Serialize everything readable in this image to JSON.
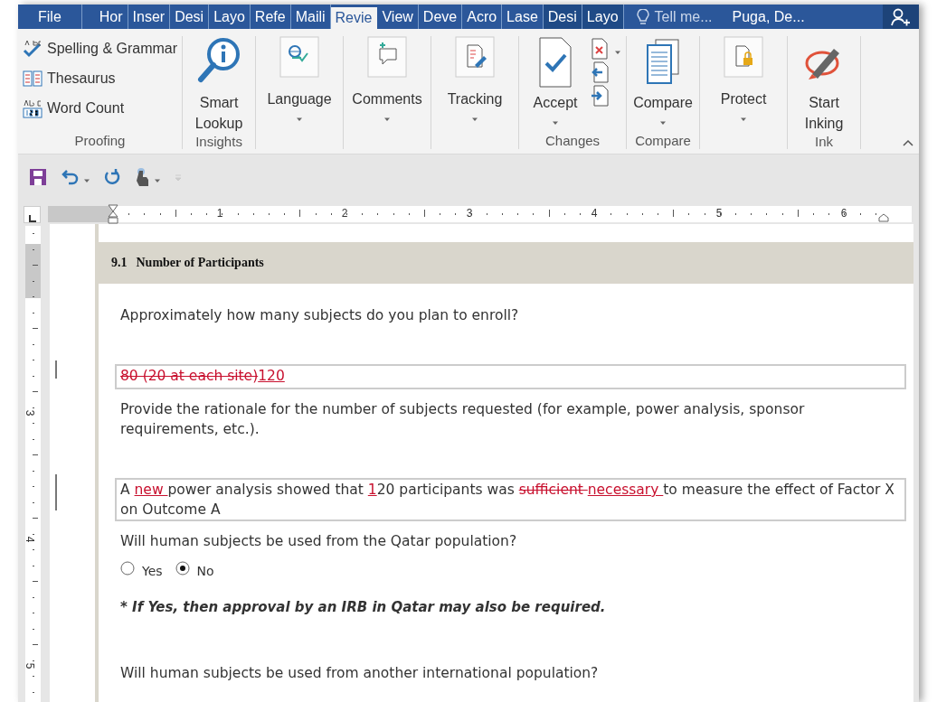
{
  "ribbon_tabs": [
    {
      "label": "File",
      "selected": false,
      "kind": "file"
    },
    {
      "label": "Hor",
      "selected": false,
      "kind": "tab"
    },
    {
      "label": "Inser",
      "selected": false,
      "kind": "tab"
    },
    {
      "label": "Desi",
      "selected": false,
      "kind": "tab"
    },
    {
      "label": "Layo",
      "selected": false,
      "kind": "tab"
    },
    {
      "label": "Refe",
      "selected": false,
      "kind": "tab"
    },
    {
      "label": "Maili",
      "selected": false,
      "kind": "tab"
    },
    {
      "label": "Revie",
      "selected": true,
      "kind": "tab"
    },
    {
      "label": "View",
      "selected": false,
      "kind": "tab"
    },
    {
      "label": "Deve",
      "selected": false,
      "kind": "tab"
    },
    {
      "label": "Acro",
      "selected": false,
      "kind": "tab"
    },
    {
      "label": "Lase",
      "selected": false,
      "kind": "tab"
    },
    {
      "label": "Desi",
      "selected": false,
      "kind": "contextual"
    },
    {
      "label": "Layo",
      "selected": false,
      "kind": "contextual"
    }
  ],
  "tell_me": {
    "placeholder": "Tell me..."
  },
  "user": "Puga, De...",
  "ribbon_groups": [
    {
      "label": "Proofing",
      "buttons": [
        {
          "kind": "small",
          "lines": [
            "Spelling & Grammar"
          ],
          "dropdown": false
        },
        {
          "kind": "small",
          "lines": [
            "Thesaurus"
          ],
          "dropdown": false
        },
        {
          "kind": "small",
          "lines": [
            "Word Count"
          ],
          "dropdown": false
        }
      ]
    },
    {
      "label": "Insights",
      "buttons": [
        {
          "kind": "large",
          "lines": [
            "Smart",
            "Lookup"
          ],
          "dropdown": false
        }
      ]
    },
    {
      "buttons": [
        {
          "kind": "boxed",
          "lines": [
            "Language"
          ],
          "dropdown": true
        }
      ]
    },
    {
      "buttons": [
        {
          "kind": "boxed",
          "lines": [
            "Comments"
          ],
          "dropdown": true
        }
      ]
    },
    {
      "buttons": [
        {
          "kind": "boxed",
          "lines": [
            "Tracking"
          ],
          "dropdown": true
        }
      ]
    },
    {
      "label": "Changes",
      "buttons": [
        {
          "kind": "large",
          "lines": [
            "Accept"
          ],
          "dropdown": true
        },
        {
          "kind": "icons"
        }
      ]
    },
    {
      "label": "Compare",
      "buttons": [
        {
          "kind": "large",
          "lines": [
            "Compare"
          ],
          "dropdown": true
        }
      ]
    },
    {
      "buttons": [
        {
          "kind": "boxed",
          "lines": [
            "Protect"
          ],
          "dropdown": true
        }
      ]
    },
    {
      "label": "Ink",
      "buttons": [
        {
          "kind": "large",
          "lines": [
            "Start",
            "Inking"
          ],
          "dropdown": false
        }
      ]
    }
  ],
  "ruler": {
    "marks": [
      "1",
      "2",
      "3",
      "4",
      "5",
      "6"
    ]
  },
  "vertical_ruler": {
    "marks": [
      "3",
      "4",
      "5"
    ]
  },
  "document": {
    "section_number": "9.1",
    "section_title": "Number of Participants",
    "blocks": [
      {
        "kind": "question",
        "text": "Approximately how many subjects do you plan to enroll?"
      },
      {
        "kind": "answer",
        "changed": true,
        "segments": [
          {
            "kind": "deleted",
            "text": "80 (20 at each site)"
          },
          {
            "kind": "inserted",
            "text": "120"
          }
        ]
      },
      {
        "kind": "question",
        "text": "Provide the rationale for the number of subjects requested (for example, power analysis, sponsor requirements, etc.)."
      },
      {
        "kind": "answer",
        "changed": true,
        "segments": [
          {
            "kind": "plain",
            "text": "A "
          },
          {
            "kind": "inserted",
            "text": "new "
          },
          {
            "kind": "plain",
            "text": "power analysis showed that "
          },
          {
            "kind": "inserted",
            "text": "1"
          },
          {
            "kind": "plain",
            "text": "20 participants was "
          },
          {
            "kind": "deleted",
            "text": "sufficient "
          },
          {
            "kind": "inserted",
            "text": "necessary "
          },
          {
            "kind": "plain",
            "text": "to measure the effect of Factor X on Outcome A"
          }
        ]
      },
      {
        "kind": "question",
        "text": "Will human subjects be used from the Qatar population?"
      },
      {
        "kind": "radios",
        "options": [
          {
            "label": "Yes",
            "selected": false
          },
          {
            "label": "No",
            "selected": true
          }
        ]
      },
      {
        "kind": "note",
        "text": "* *If Yes, then approval by an IRB in Qatar may also be required.*"
      },
      {
        "kind": "question",
        "text": "Will human subjects be used from another international population?"
      }
    ]
  }
}
